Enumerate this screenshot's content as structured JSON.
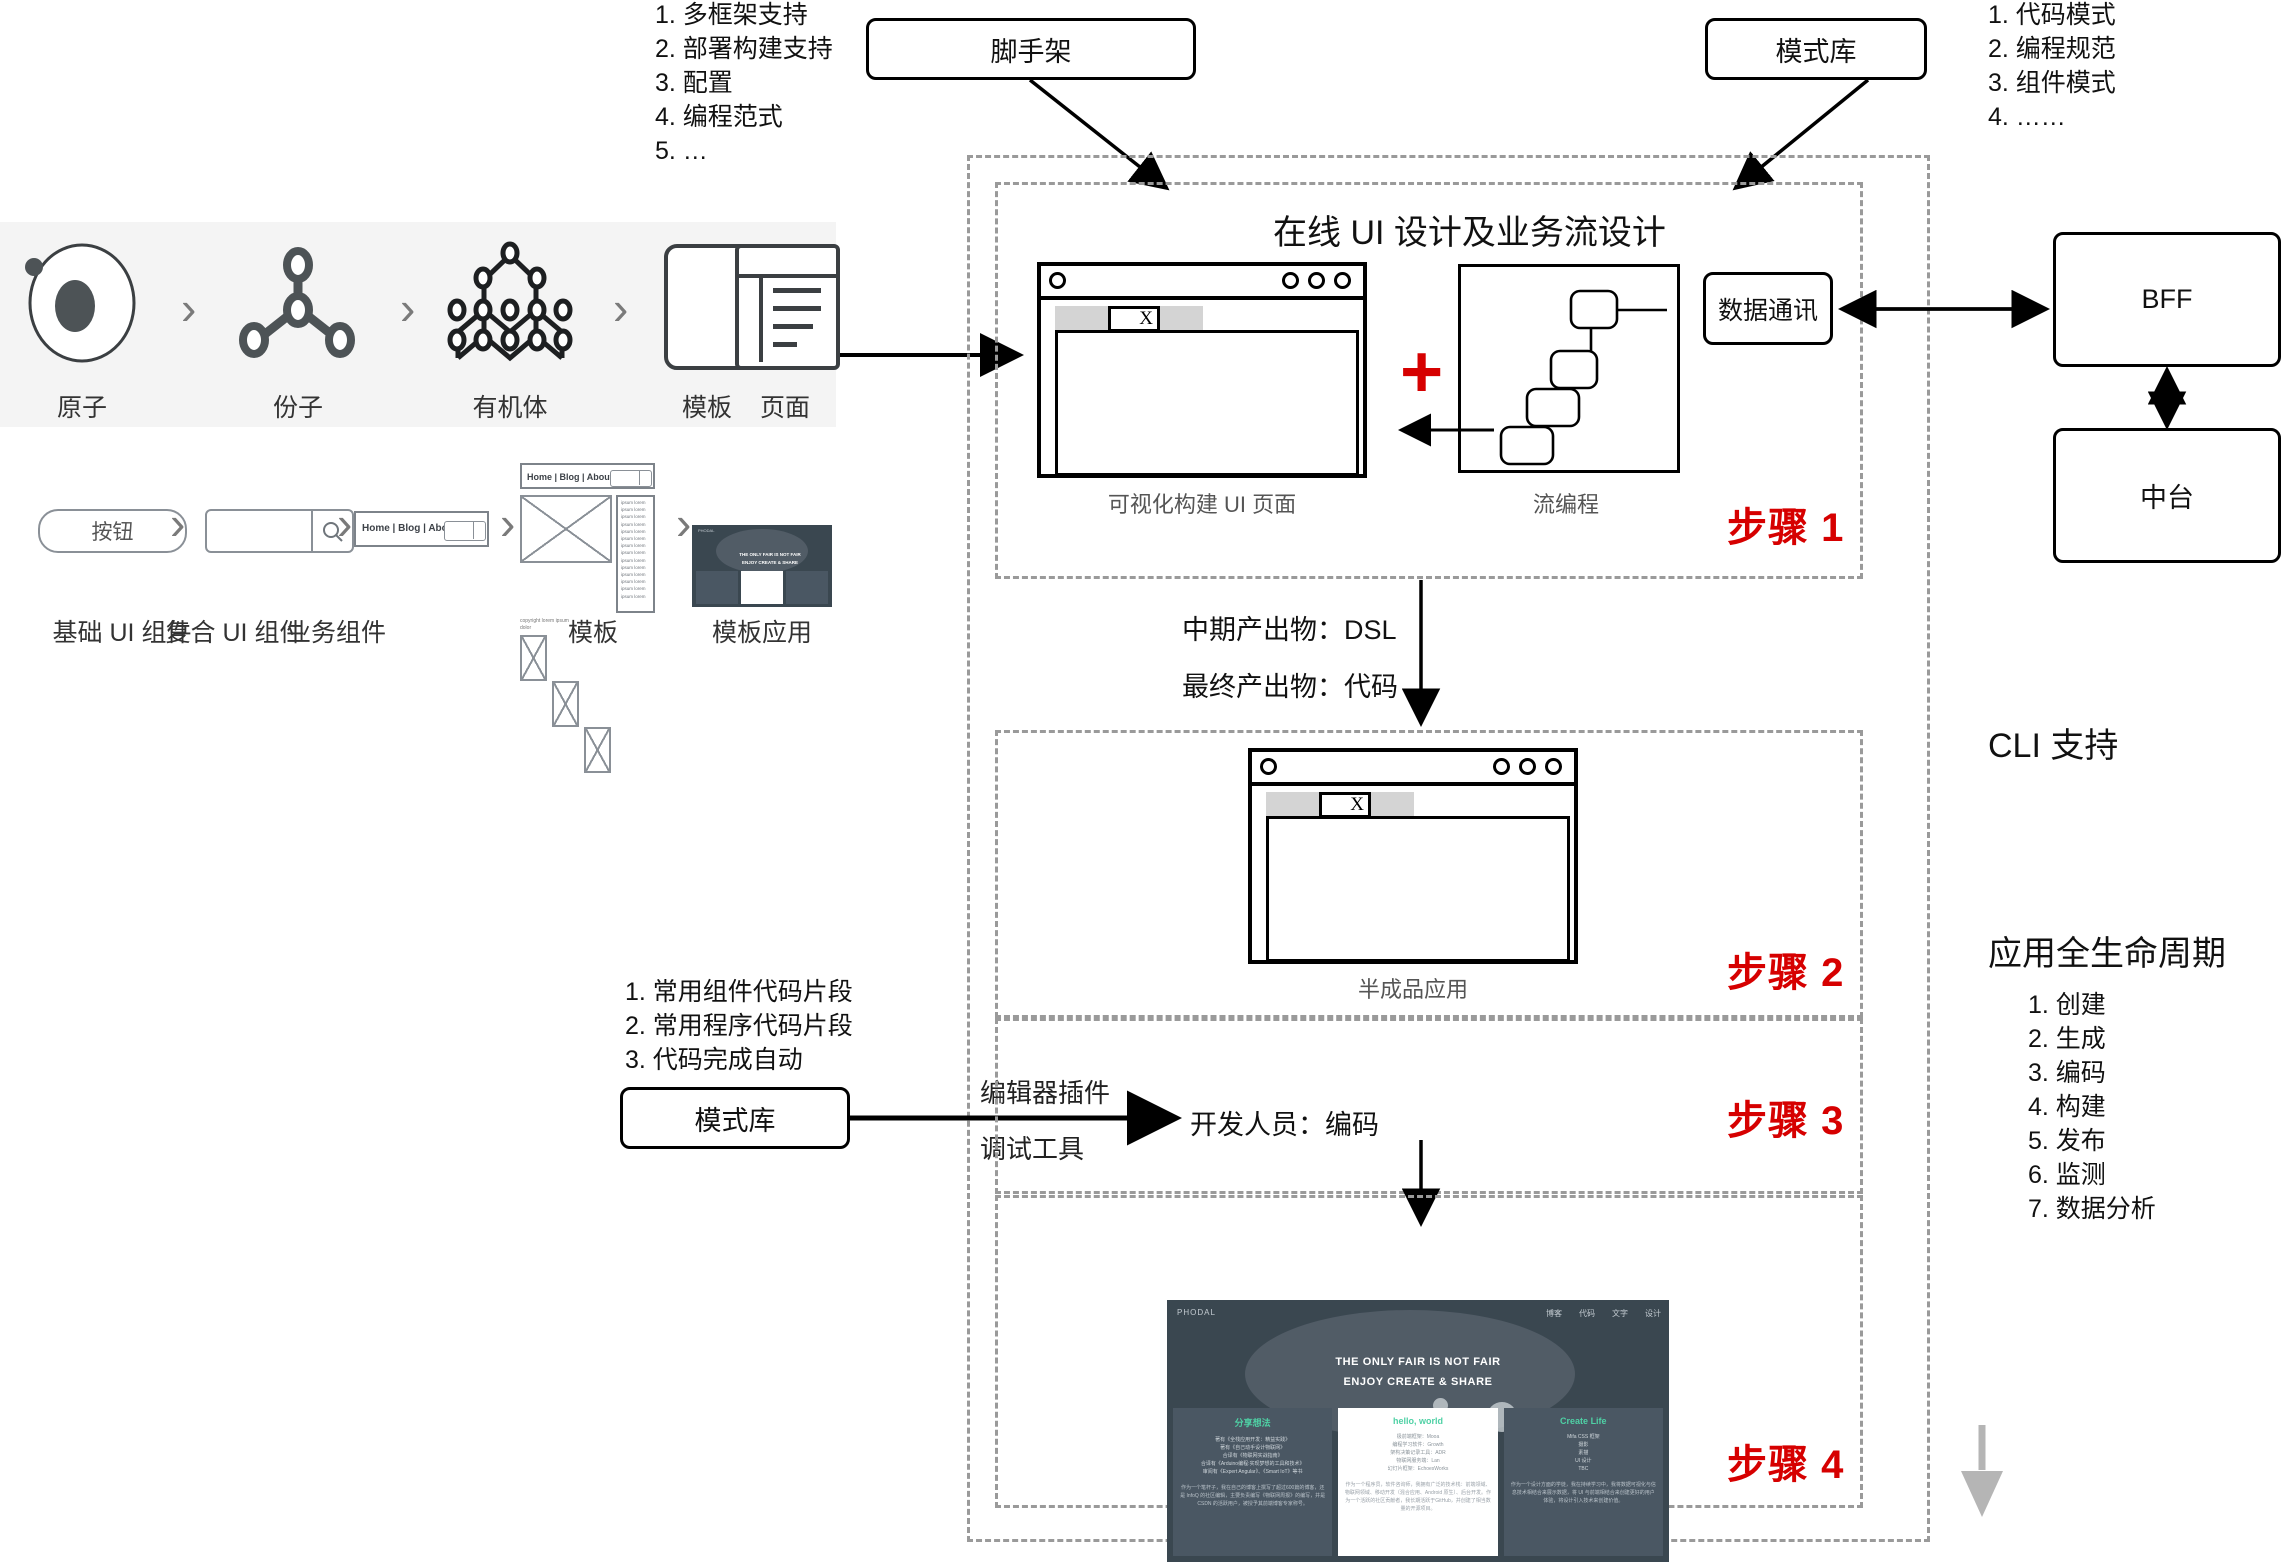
{
  "scaffold_list": {
    "items": [
      "1. 多框架支持",
      "2. 部署构建支持",
      "3. 配置",
      "4. 编程范式",
      "5. …"
    ]
  },
  "pattern_list": {
    "items": [
      "1. 代码模式",
      "2. 编程规范",
      "3. 组件模式",
      "4. ……"
    ]
  },
  "boxes": {
    "scaffold": "脚手架",
    "pattern_lib_top": "模式库",
    "pattern_lib_bottom": "模式库",
    "data_comm": "数据通讯",
    "bff": "BFF",
    "middle_platform": "中台"
  },
  "atomic": {
    "items": [
      {
        "label": "原子",
        "icon": "atom-icon"
      },
      {
        "label": "份子",
        "icon": "molecule-icon"
      },
      {
        "label": "有机体",
        "icon": "organism-icon"
      },
      {
        "label": "模板",
        "icon": "template-icon"
      },
      {
        "label": "页面",
        "icon": "page-icon"
      }
    ],
    "chevron": "›"
  },
  "components_row": {
    "items": [
      {
        "label": "基础 UI 组件",
        "sample": "按钮"
      },
      {
        "label": "复合 UI 组件",
        "sample": ""
      },
      {
        "label": "业务组件",
        "sample": "Home | Blog | About"
      },
      {
        "label": "模板",
        "sample": "Home | Blog | About"
      },
      {
        "label": "模板应用",
        "sample": ""
      }
    ],
    "chevron": "›"
  },
  "step1": {
    "title": "在线 UI 设计及业务流设计",
    "left_caption": "可视化构建 UI 页面",
    "right_caption": "流编程",
    "plus": "+",
    "step_label": "步骤 1"
  },
  "outputs": {
    "interim": "中期产出物：DSL",
    "final": "最终产出物：代码"
  },
  "step2": {
    "caption": "半成品应用",
    "step_label": "步骤 2"
  },
  "step3": {
    "snippet_list": [
      "1. 常用组件代码片段",
      "2. 常用程序代码片段",
      "3. 代码完成自动"
    ],
    "editor_plugin": "编辑器插件",
    "debug_tool": "调试工具",
    "developer_coding": "开发人员：编码",
    "step_label": "步骤 3"
  },
  "step4": {
    "step_label": "步骤 4",
    "site": {
      "brand": "PHODAL",
      "nav": [
        "博客",
        "代码",
        "文字",
        "设计"
      ],
      "hero_line1": "THE ONLY FAIR IS NOT FAIR",
      "hero_line2": "ENJOY CREATE & SHARE",
      "columns": [
        {
          "title": "分享想法",
          "lines": [
            "著有《全栈应用开发：精益实践》",
            "著有《自己动手设计物联网》",
            "合译有《物联网实战指南》",
            "合译有《Arduino编程:实现梦想的工具和技术》",
            "审阅有《Expert Angular》、《Smart IoT》等书"
          ],
          "para": "作为一个笔杆子，我在自己的博客上撰写了超过600篇的博客，还是 InfoQ 的社区编辑，主要负责编写《物联网周报》的编写，并是 CSDN 的活跃用户，被授予其前端博客专家称号。"
        },
        {
          "title": "hello, world",
          "lines": [
            "极前端框架：Mooa",
            "编程学习软件：Growth",
            "架构决策记录工具：ADR",
            "物联网服务端：Lan",
            "幻灯片框架：EchoesWorks"
          ],
          "para": "作为一个程序员，软件咨询师，我拥有广泛的技术栈：前端领域、物联网领域、移动开发（混合应用、Android 原生）、后台开发。作为一个活跃的社区贡献者，我长期活跃于GitHub，并创建了相当数量的开源项目。"
        },
        {
          "title": "Create Life",
          "lines": [
            "Mifa CSS 框架",
            "摄影",
            "素描",
            "UI 设计",
            "TBC"
          ],
          "para": "作为一个设计方面的学徒，我在持续学习中，我将数据可视化与信息技术相结合来展示数据，将 UI 与前端相结合来创建更好的用户体验，将设计引入技术来创建价值。"
        }
      ]
    }
  },
  "right_column": {
    "cli_support": "CLI 支持",
    "lifecycle_title": "应用全生命周期",
    "lifecycle_items": [
      "1. 创建",
      "2. 生成",
      "3. 编码",
      "4. 构建",
      "5. 发布",
      "6. 监测",
      "7. 数据分析"
    ]
  },
  "colors": {
    "red": "#d60000",
    "dash_gray": "#9a9a9a",
    "strip_bg": "#f4f4f4",
    "site_bg": "#3a4750",
    "site_accent": "#4fd1a5"
  }
}
